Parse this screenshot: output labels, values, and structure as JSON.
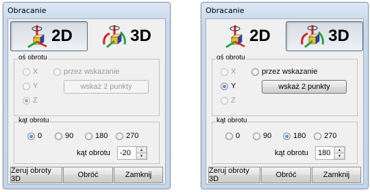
{
  "dialogs": [
    {
      "title": "Obracanie",
      "mode_2d_label": "2D",
      "mode_3d_label": "3D",
      "pressed_mode": "2D",
      "axis_group_label": "oś obrotu",
      "axis_x": "X",
      "axis_y": "Y",
      "axis_z": "Z",
      "selected_axis": "Z",
      "axis_enabled": false,
      "by_indication_label": "przez wskazanie",
      "indicate_points_label": "wskaż 2 punkty",
      "indicate_enabled": false,
      "angle_group_label": "kąt obrotu",
      "angle_options": [
        "0",
        "90",
        "180",
        "270"
      ],
      "selected_angle": "0",
      "angle_field_label": "kąt obrotu",
      "angle_value": "-20",
      "reset_3d_label": "Zeruj obroty 3D",
      "rotate_label": "Obróć",
      "close_label": "Zamknij"
    },
    {
      "title": "Obracanie",
      "mode_2d_label": "2D",
      "mode_3d_label": "3D",
      "pressed_mode": "3D",
      "axis_group_label": "oś obrotu",
      "axis_x": "X",
      "axis_y": "Y",
      "axis_z": "Z",
      "selected_axis": "Y",
      "axis_enabled": true,
      "by_indication_label": "przez wskazanie",
      "indicate_points_label": "wskaż 2 punkty",
      "indicate_enabled": true,
      "angle_group_label": "kąt obrotu",
      "angle_options": [
        "0",
        "90",
        "180",
        "270"
      ],
      "selected_angle": "180",
      "angle_field_label": "kąt obrotu",
      "angle_value": "180",
      "reset_3d_label": "Zeruj obroty 3D",
      "rotate_label": "Obróć",
      "close_label": "Zamknij"
    }
  ],
  "colors": {
    "radio_selected": "#1c5cc6",
    "icon_red": "#d62020",
    "icon_yellow": "#f0c020",
    "icon_green": "#2aa040",
    "icon_blue": "#2040d0"
  },
  "icons": {
    "mode_2d": "axis-cube-icon",
    "mode_3d": "rotate-cube-icon",
    "spin": "spin-arrows-icon"
  }
}
